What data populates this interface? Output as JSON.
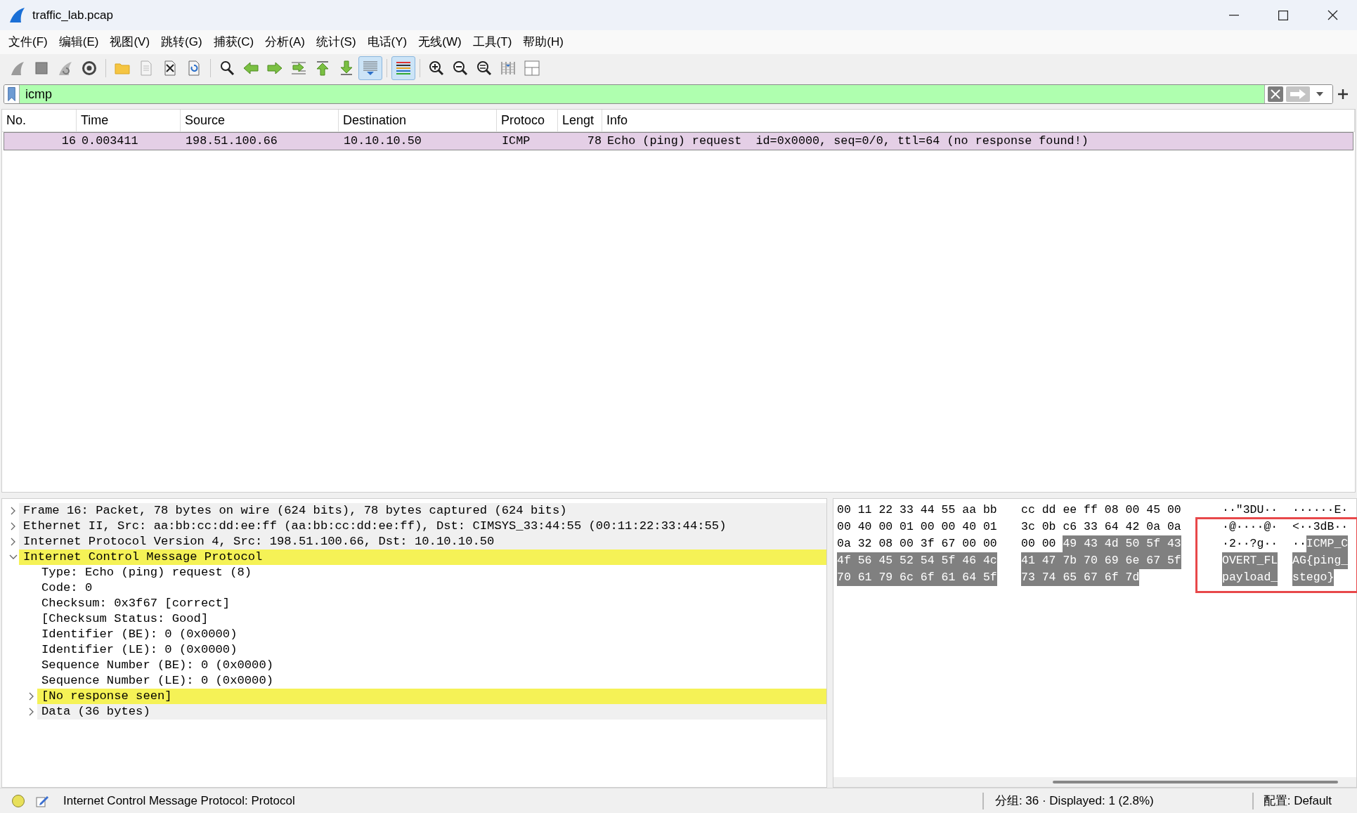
{
  "window": {
    "title": "traffic_lab.pcap"
  },
  "menu": [
    "文件(F)",
    "编辑(E)",
    "视图(V)",
    "跳转(G)",
    "捕获(C)",
    "分析(A)",
    "统计(S)",
    "电话(Y)",
    "无线(W)",
    "工具(T)",
    "帮助(H)"
  ],
  "toolbar_groups": [
    [
      {
        "kind": "fin",
        "pressed": false
      },
      {
        "kind": "stop",
        "pressed": false
      },
      {
        "kind": "restart",
        "pressed": false
      },
      {
        "kind": "options",
        "pressed": false
      }
    ],
    [
      {
        "kind": "open",
        "pressed": false
      },
      {
        "kind": "file",
        "pressed": false
      },
      {
        "kind": "close-file",
        "pressed": false
      },
      {
        "kind": "reload",
        "pressed": false
      }
    ],
    [
      {
        "kind": "find",
        "pressed": false
      },
      {
        "kind": "back",
        "pressed": false
      },
      {
        "kind": "forward",
        "pressed": false
      },
      {
        "kind": "goto",
        "pressed": false
      },
      {
        "kind": "first",
        "pressed": false
      },
      {
        "kind": "last",
        "pressed": false
      },
      {
        "kind": "autoscroll",
        "pressed": true
      }
    ],
    [
      {
        "kind": "colorize",
        "pressed": true
      }
    ],
    [
      {
        "kind": "zoom-in",
        "pressed": false
      },
      {
        "kind": "zoom-out",
        "pressed": false
      },
      {
        "kind": "zoom-normal",
        "pressed": false
      },
      {
        "kind": "resize-columns",
        "pressed": false
      },
      {
        "kind": "layout",
        "pressed": false
      }
    ]
  ],
  "filter": {
    "value": "icmp",
    "valid": true
  },
  "packet_list": {
    "columns": [
      "No.",
      "Time",
      "Source",
      "Destination",
      "Protoco",
      "Lengt",
      "Info"
    ],
    "rows": [
      {
        "cells": [
          "16",
          "0.003411",
          "198.51.100.66",
          "10.10.10.50",
          "ICMP",
          "78",
          "Echo (ping) request  id=0x0000, seq=0/0, ttl=64 (no response found!)"
        ],
        "color": "#e4cfe6",
        "selected": false
      }
    ]
  },
  "details": [
    {
      "kind": "branch",
      "label": "Frame 16: Packet, 78 bytes on wire (624 bits), 78 bytes captured (624 bits)",
      "expanded": false,
      "highlighted": false
    },
    {
      "kind": "branch",
      "label": "Ethernet II, Src: aa:bb:cc:dd:ee:ff (aa:bb:cc:dd:ee:ff), Dst: CIMSYS_33:44:55 (00:11:22:33:44:55)",
      "expanded": false,
      "highlighted": false
    },
    {
      "kind": "branch",
      "label": "Internet Protocol Version 4, Src: 198.51.100.66, Dst: 10.10.10.50",
      "expanded": false,
      "highlighted": false
    },
    {
      "kind": "branch",
      "label": "Internet Control Message Protocol",
      "expanded": true,
      "highlighted": true,
      "children": [
        {
          "kind": "field",
          "label": "Type: Echo (ping) request (8)",
          "highlighted": false
        },
        {
          "kind": "field",
          "label": "Code: 0",
          "highlighted": false
        },
        {
          "kind": "field",
          "label": "Checksum: 0x3f67 [correct]",
          "highlighted": false
        },
        {
          "kind": "field",
          "label": "[Checksum Status: Good]",
          "highlighted": false
        },
        {
          "kind": "field",
          "label": "Identifier (BE): 0 (0x0000)",
          "highlighted": false
        },
        {
          "kind": "field",
          "label": "Identifier (LE): 0 (0x0000)",
          "highlighted": false
        },
        {
          "kind": "field",
          "label": "Sequence Number (BE): 0 (0x0000)",
          "highlighted": false
        },
        {
          "kind": "field",
          "label": "Sequence Number (LE): 0 (0x0000)",
          "highlighted": false
        },
        {
          "kind": "branch",
          "label": "[No response seen]",
          "expanded": false,
          "highlighted": true
        },
        {
          "kind": "branch",
          "label": "Data (36 bytes)",
          "expanded": false,
          "highlighted": false
        }
      ]
    }
  ],
  "bytes": [
    {
      "hex": [
        [
          {
            "text": "00 11 22 33 44 55 aa bb",
            "selected": false
          }
        ],
        [
          {
            "text": "cc dd ee ff 08 00 45 00",
            "selected": false
          }
        ]
      ],
      "ascii": [
        [
          {
            "text": "··\"3DU··",
            "selected": false
          }
        ],
        [
          {
            "text": "······E·",
            "selected": false
          }
        ]
      ]
    },
    {
      "hex": [
        [
          {
            "text": "00 40 00 01 00 00 40 01",
            "selected": false
          }
        ],
        [
          {
            "text": "3c 0b c6 33 64 42 0a 0a",
            "selected": false
          }
        ]
      ],
      "ascii": [
        [
          {
            "text": "·@····@·",
            "selected": false
          }
        ],
        [
          {
            "text": "<··3dB··",
            "selected": false
          }
        ]
      ]
    },
    {
      "hex": [
        [
          {
            "text": "0a 32 08 00 3f 67 00 00",
            "selected": false
          }
        ],
        [
          {
            "text": "00 00 ",
            "selected": false
          },
          {
            "text": "49 43 4d 50 5f 43",
            "selected": true
          }
        ]
      ],
      "ascii": [
        [
          {
            "text": "·2··?g··",
            "selected": false
          }
        ],
        [
          {
            "text": "··",
            "selected": false
          },
          {
            "text": "ICMP_C",
            "selected": true
          }
        ]
      ]
    },
    {
      "hex": [
        [
          {
            "text": "4f 56 45 52 54 5f 46 4c",
            "selected": true
          }
        ],
        [
          {
            "text": "41 47 7b 70 69 6e 67 5f",
            "selected": true
          }
        ]
      ],
      "ascii": [
        [
          {
            "text": "OVERT_FL",
            "selected": true
          }
        ],
        [
          {
            "text": "AG{ping_",
            "selected": true
          }
        ]
      ]
    },
    {
      "hex": [
        [
          {
            "text": "70 61 79 6c 6f 61 64 5f",
            "selected": true
          }
        ],
        [
          {
            "text": "73 74 65 67 6f 7d",
            "selected": true
          }
        ]
      ],
      "ascii": [
        [
          {
            "text": "payload_",
            "selected": true
          }
        ],
        [
          {
            "text": "stego}",
            "selected": true
          }
        ]
      ]
    }
  ],
  "status_bar": {
    "message": "Internet Control Message Protocol: Protocol",
    "packets": "分组: 36 · Displayed: 1 (2.8%)",
    "profile": "配置: Default"
  }
}
